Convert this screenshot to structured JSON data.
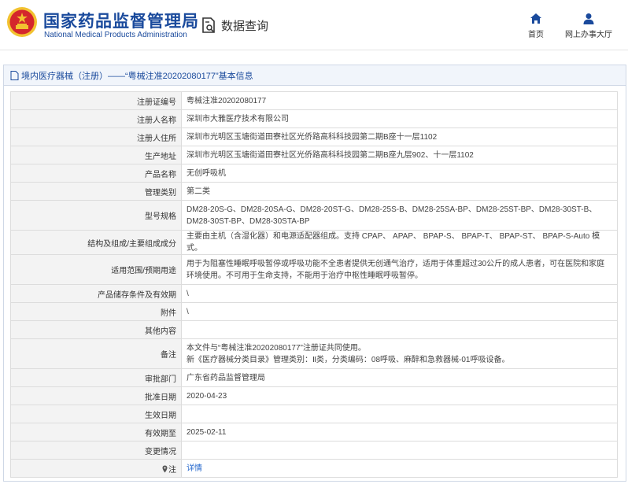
{
  "header": {
    "brand_cn": "国家药品监督管理局",
    "brand_en": "National Medical Products Administration",
    "query_label": "数据查询",
    "nav": [
      {
        "label": "首页",
        "icon": "home-icon"
      },
      {
        "label": "网上办事大厅",
        "icon": "user-icon"
      }
    ]
  },
  "panel": {
    "title": "境内医疗器械（注册）——“粤械注准20202080177”基本信息"
  },
  "rows": [
    {
      "label": "注册证编号",
      "value": "粤械注准20202080177"
    },
    {
      "label": "注册人名称",
      "value": "深圳市大雅医疗技术有限公司"
    },
    {
      "label": "注册人住所",
      "value": "深圳市光明区玉塘街道田寮社区光侨路高科科技园第二期B座十一层1102"
    },
    {
      "label": "生产地址",
      "value": "深圳市光明区玉塘街道田寮社区光侨路高科科技园第二期B座九层902、十一层1102"
    },
    {
      "label": "产品名称",
      "value": "无创呼吸机"
    },
    {
      "label": "管理类别",
      "value": "第二类"
    },
    {
      "label": "型号规格",
      "value": "DM28-20S-G、DM28-20SA-G、DM28-20ST-G、DM28-25S-B、DM28-25SA-BP、DM28-25ST-BP、DM28-30ST-B、DM28-30ST-BP、DM28-30STA-BP"
    },
    {
      "label": "结构及组成/主要组成成分",
      "value": "主要由主机（含湿化器）和电源适配器组成。支持 CPAP、 APAP、 BPAP-S、 BPAP-T、 BPAP-ST、 BPAP-S-Auto 模式。"
    },
    {
      "label": "适用范围/预期用途",
      "value": "用于为阻塞性睡眠呼吸暂停或呼吸功能不全患者提供无创通气治疗，适用于体重超过30公斤的成人患者，可在医院和家庭环境使用。不可用于生命支持，不能用于治疗中枢性睡眠呼吸暂停。"
    },
    {
      "label": "产品储存条件及有效期",
      "value": "\\"
    },
    {
      "label": "附件",
      "value": "\\"
    },
    {
      "label": "其他内容",
      "value": ""
    },
    {
      "label": "备注",
      "value_lines": [
        "本文件与“粤械注准20202080177”注册证共同使用。",
        "新《医疗器械分类目录》管理类别：Ⅱ类，分类编码：08呼吸、麻醉和急救器械-01呼吸设备。"
      ]
    },
    {
      "label": "审批部门",
      "value": "广东省药品监督管理局"
    },
    {
      "label": "批准日期",
      "value": "2020-04-23"
    },
    {
      "label": "生效日期",
      "value": ""
    },
    {
      "label": "有效期至",
      "value": "2025-02-11"
    },
    {
      "label": "变更情况",
      "value": ""
    },
    {
      "label": "注",
      "value": "详情"
    }
  ],
  "colors": {
    "brand": "#1a4a9c",
    "link": "#2266cc",
    "logo_red": "#d4262c",
    "logo_gold": "#f2c230"
  }
}
